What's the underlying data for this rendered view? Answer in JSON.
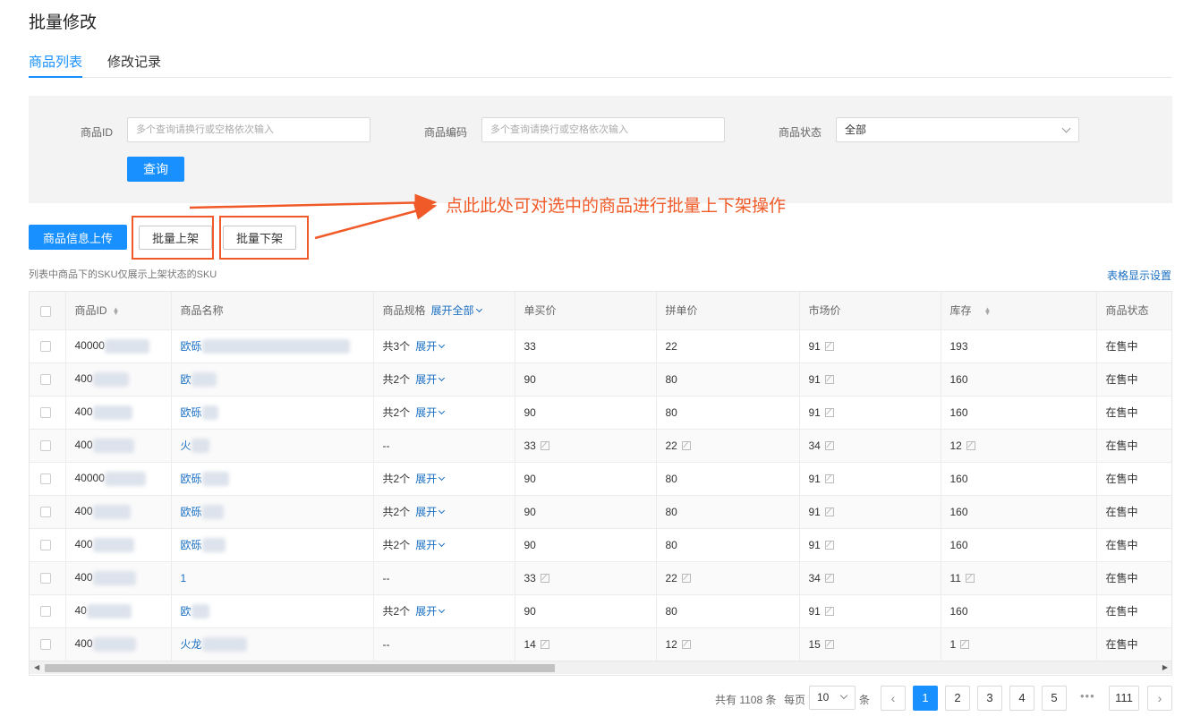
{
  "page": {
    "title": "批量修改"
  },
  "tabs": [
    {
      "label": "商品列表",
      "active": true
    },
    {
      "label": "修改记录",
      "active": false
    }
  ],
  "filters": {
    "product_id": {
      "label": "商品ID",
      "placeholder": "多个查询请换行或空格依次输入",
      "value": ""
    },
    "product_code": {
      "label": "商品编码",
      "placeholder": "多个查询请换行或空格依次输入",
      "value": ""
    },
    "product_status": {
      "label": "商品状态",
      "value": "全部"
    },
    "query_label": "查询"
  },
  "actions": {
    "upload_label": "商品信息上传",
    "batch_on_label": "批量上架",
    "batch_off_label": "批量下架",
    "annotation": "点此此处可对选中的商品进行批量上下架操作"
  },
  "note": "列表中商品下的SKU仅展示上架状态的SKU",
  "table_settings_label": "表格显示设置",
  "table": {
    "headers": {
      "id": "商品ID",
      "name": "商品名称",
      "spec": "商品规格",
      "expand_all": "展开全部",
      "price_single": "单买价",
      "price_group": "拼单价",
      "price_market": "市场价",
      "stock": "库存",
      "status": "商品状态"
    },
    "rows": [
      {
        "id": "40000",
        "name": "欧砾",
        "spec": "共3个",
        "expand": "展开",
        "single": "33",
        "group": "22",
        "market": "91",
        "stock": "193",
        "status": "在售中"
      },
      {
        "id": "400",
        "name": "欧",
        "spec": "共2个",
        "expand": "展开",
        "single": "90",
        "group": "80",
        "market": "91",
        "stock": "160",
        "status": "在售中"
      },
      {
        "id": "400",
        "name": "欧砾",
        "spec": "共2个",
        "expand": "展开",
        "single": "90",
        "group": "80",
        "market": "91",
        "stock": "160",
        "status": "在售中"
      },
      {
        "id": "400",
        "name": "火",
        "spec": "--",
        "expand": "",
        "single": "33",
        "group": "22",
        "market": "34",
        "stock": "12",
        "status": "在售中"
      },
      {
        "id": "40000",
        "name": "欧砾",
        "spec": "共2个",
        "expand": "展开",
        "single": "90",
        "group": "80",
        "market": "91",
        "stock": "160",
        "status": "在售中"
      },
      {
        "id": "400",
        "name": "欧砾",
        "spec": "共2个",
        "expand": "展开",
        "single": "90",
        "group": "80",
        "market": "91",
        "stock": "160",
        "status": "在售中"
      },
      {
        "id": "400",
        "name": "欧砾",
        "spec": "共2个",
        "expand": "展开",
        "single": "90",
        "group": "80",
        "market": "91",
        "stock": "160",
        "status": "在售中"
      },
      {
        "id": "400",
        "name": "1",
        "spec": "--",
        "expand": "",
        "single": "33",
        "group": "22",
        "market": "34",
        "stock": "11",
        "status": "在售中"
      },
      {
        "id": "40",
        "name": "欧",
        "spec": "共2个",
        "expand": "展开",
        "single": "90",
        "group": "80",
        "market": "91",
        "stock": "160",
        "status": "在售中"
      },
      {
        "id": "400",
        "name": "火龙",
        "spec": "--",
        "expand": "",
        "single": "14",
        "group": "12",
        "market": "15",
        "stock": "1",
        "status": "在售中"
      }
    ]
  },
  "pagination": {
    "total": "共有 1108 条",
    "per_page_label": "每页",
    "page_size": "10",
    "unit": "条",
    "pages": [
      "1",
      "2",
      "3",
      "4",
      "5"
    ],
    "ellipsis": "•••",
    "last": "111",
    "current": "1"
  }
}
